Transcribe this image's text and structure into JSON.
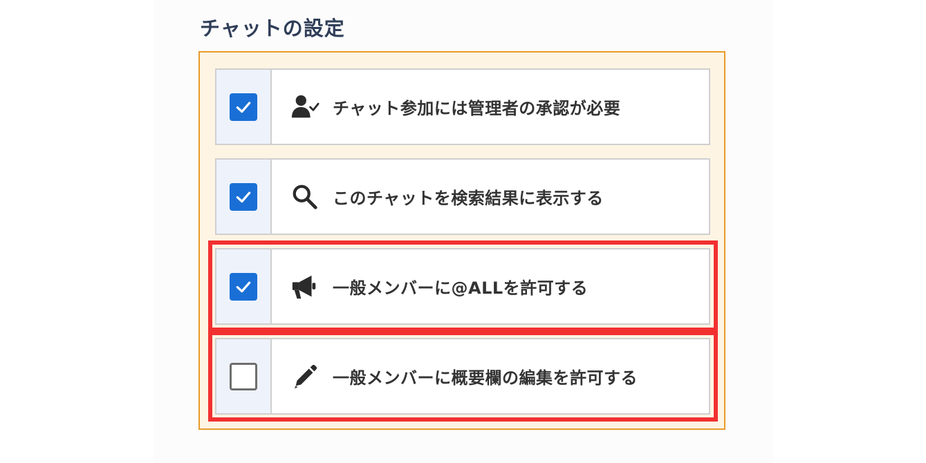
{
  "chat_settings": {
    "title": "チャットの設定",
    "options": [
      {
        "label": "チャット参加には管理者の承認が必要",
        "checked": true,
        "icon": "user-check-icon"
      },
      {
        "label": "このチャットを検索結果に表示する",
        "checked": true,
        "icon": "search-icon"
      },
      {
        "label": "一般メンバーに@ALLを許可する",
        "checked": true,
        "icon": "megaphone-icon"
      },
      {
        "label": "一般メンバーに概要欄の編集を許可する",
        "checked": false,
        "icon": "pencil-icon"
      }
    ]
  },
  "colors": {
    "checkbox_checked": "#1a6fd6",
    "box_border": "#e89a2b",
    "box_background": "#fdf4e3",
    "highlight": "#f23030",
    "title": "#2f3e58"
  }
}
